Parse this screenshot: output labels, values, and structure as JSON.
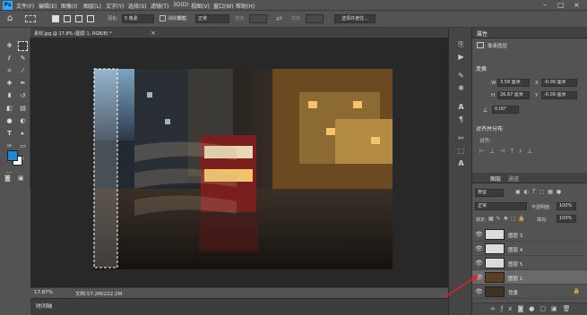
{
  "menubar": {
    "items": [
      "文件(F)",
      "编辑(E)",
      "图像(I)",
      "图层(L)",
      "文字(Y)",
      "选择(S)",
      "滤镜(T)",
      "3D(D)",
      "视图(V)",
      "窗口(W)",
      "帮助(H)"
    ]
  },
  "options": {
    "feather_label": "羽化:",
    "feather_value": "5 像素",
    "antialias_label": "消除锯齿",
    "style_label": "样式:",
    "style_value": "正常",
    "width_label": "宽度:",
    "height_label": "高度:",
    "select_mask_button": "选择并遮住..."
  },
  "document": {
    "tab_title": "素材.jpg @ 17.8% (图层 1, RGB/8) *",
    "zoom": "17.87%",
    "doc_size": "文档:57.2M/222.2M"
  },
  "timeline_tab": "时间轴",
  "properties": {
    "tab": "属性",
    "subtitle": "像素图层",
    "transform_title": "变换",
    "w_label": "W",
    "w_value": "3.58 厘米",
    "h_label": "H",
    "h_value": "26.67 厘米",
    "x_label": "X",
    "x_value": "-0.09 厘米",
    "y_label": "Y",
    "y_value": "-0.09 厘米",
    "angle_value": "0.00°",
    "align_title": "对齐并分布",
    "align_label": "对齐:"
  },
  "layers_panel": {
    "tabs": [
      "图层",
      "通道"
    ],
    "filter_kind": "类型",
    "blend_mode": "正常",
    "opacity_label": "不透明度:",
    "opacity_value": "100%",
    "lock_label": "锁定:",
    "fill_label": "填充:",
    "fill_value": "100%",
    "layers": [
      {
        "name": "图层 3",
        "selected": false
      },
      {
        "name": "图层 4",
        "selected": false
      },
      {
        "name": "图层 5",
        "selected": false
      },
      {
        "name": "图层 1",
        "selected": true
      },
      {
        "name": "背景",
        "selected": false
      }
    ]
  },
  "colors": {
    "foreground": "#1e88d8",
    "background": "#ffffff",
    "accent": "#31a8ff",
    "annotation_arrow": "#e0262c"
  }
}
